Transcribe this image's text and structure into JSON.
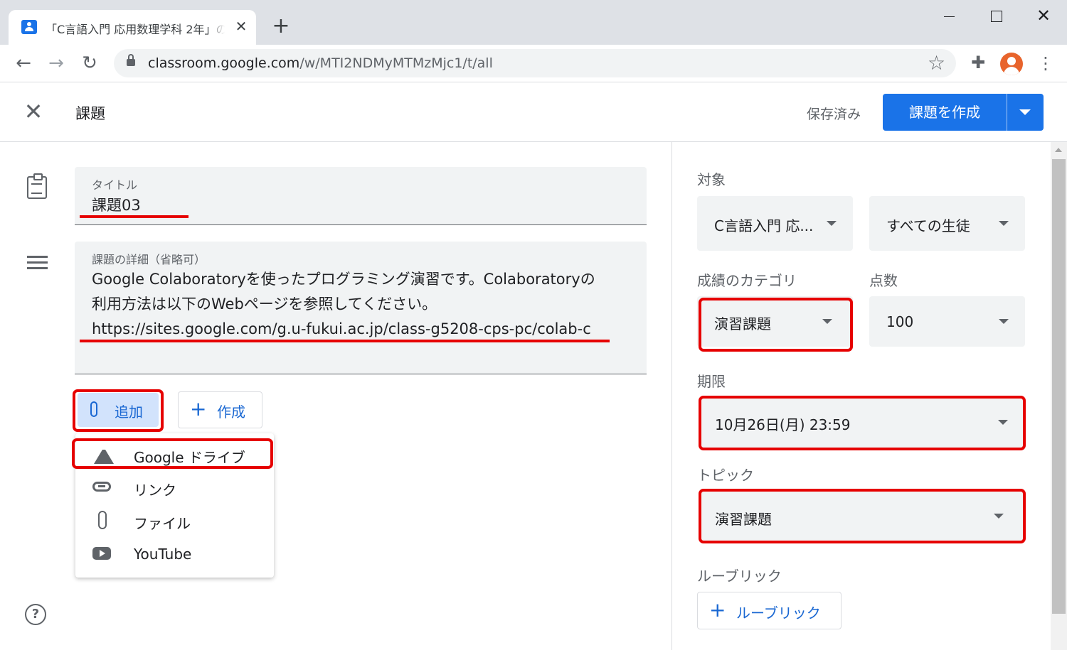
{
  "browser": {
    "tab_title": "「C言語入門 応用数理学科 2年」の",
    "tab_close": "✕",
    "new_tab": "+",
    "url_host": "classroom.google.com",
    "url_path": "/w/MTI2NDMyMTMzMjc1/t/all"
  },
  "header": {
    "title": "課題",
    "saved": "保存済み",
    "create_button": "課題を作成"
  },
  "form": {
    "title_label": "タイトル",
    "title_value": "課題03",
    "detail_label": "課題の詳細（省略可）",
    "detail_lines": [
      "Google Colaboratoryを使ったプログラミング演習です。Colaboratoryの",
      "利用方法は以下のWebページを参照してください。",
      "https://sites.google.com/g.u-fukui.ac.jp/class-g5208-cps-pc/colab-c"
    ],
    "add_button": "追加",
    "compose_button": "作成"
  },
  "attach_menu": {
    "items": [
      {
        "label": "Google ドライブ",
        "icon": "google-drive-icon"
      },
      {
        "label": "リンク",
        "icon": "link-icon"
      },
      {
        "label": "ファイル",
        "icon": "paperclip-icon"
      },
      {
        "label": "YouTube",
        "icon": "youtube-icon"
      }
    ]
  },
  "settings": {
    "target_label": "対象",
    "class_value": "C言語入門 応...",
    "students_value": "すべての生徒",
    "grade_category_label": "成績のカテゴリ",
    "grade_category_value": "演習課題",
    "points_label": "点数",
    "points_value": "100",
    "due_label": "期限",
    "due_value": "10月26日(月) 23:59",
    "topic_label": "トピック",
    "topic_value": "演習課題",
    "rubric_label": "ルーブリック",
    "rubric_button": "ルーブリック"
  },
  "colors": {
    "primary": "#1a73e8",
    "annotation_red": "#e60000"
  }
}
